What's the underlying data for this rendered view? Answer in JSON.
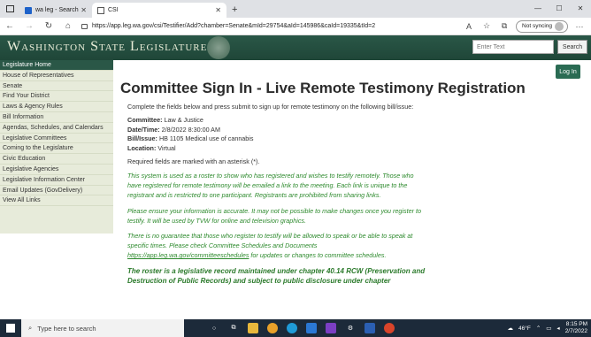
{
  "browser": {
    "tabs": [
      {
        "label": "wa leg - Search",
        "active": false
      },
      {
        "label": "CSI",
        "active": true
      }
    ],
    "new_tab": "+",
    "url": "https://app.leg.wa.gov/csi/Testifier/Add?chamber=Senate&mId=29754&aId=145986&caId=19335&tId=2",
    "sync_label": "Not syncing",
    "window_controls": [
      "—",
      "☐",
      "✕"
    ]
  },
  "site": {
    "title": "Washington State Legislature",
    "search_placeholder": "Enter Text",
    "search_button": "Search",
    "login_button": "Log In"
  },
  "sidebar": {
    "items": [
      "Legislature Home",
      "House of Representatives",
      "Senate",
      "Find Your District",
      "Laws & Agency Rules",
      "Bill Information",
      "Agendas, Schedules, and Calendars",
      "Legislative Committees",
      "Coming to the Legislature",
      "Civic Education",
      "Legislative Agencies",
      "Legislative Information Center",
      "Email Updates (GovDelivery)",
      "View All Links"
    ]
  },
  "main": {
    "heading": "Committee Sign In - Live Remote Testimony Registration",
    "intro": "Complete the fields below and press submit to sign up for remote testimony on the following bill/issue:",
    "committee_label": "Committee:",
    "committee_value": "Law & Justice",
    "datetime_label": "Date/Time:",
    "datetime_value": "2/8/2022 8:30:00 AM",
    "bill_label": "Bill/Issue:",
    "bill_value": "HB 1105 Medical use of cannabis",
    "location_label": "Location:",
    "location_value": "Virtual",
    "required_note": "Required fields are marked with an asterisk (*).",
    "notice1": "This system is used as a roster to show who has registered and wishes to testify remotely. Those who have registered for remote testimony will be emailed a link to the meeting. Each link is unique to the registrant and is restricted to one participant. Registrants are prohibited from sharing links.",
    "notice2": "Please ensure your information is accurate. It may not be possible to make changes once you register to testify. It will be used by TVW for online and television graphics.",
    "notice3_pre": "There is no guarantee that those who register to testify will be allowed to speak or be able to speak at specific times. Please check Committee Schedules and Documents ",
    "notice3_link": "https://app.leg.wa.gov/committeeschedules",
    "notice3_post": " for updates or changes to committee schedules.",
    "notice4": "The roster is a legislative record maintained under chapter 40.14 RCW (Preservation and Destruction of Public Records) and subject to public disclosure under chapter"
  },
  "taskbar": {
    "search_placeholder": "Type here to search",
    "weather": "46°F",
    "time": "8:15 PM",
    "date": "2/7/2022"
  }
}
